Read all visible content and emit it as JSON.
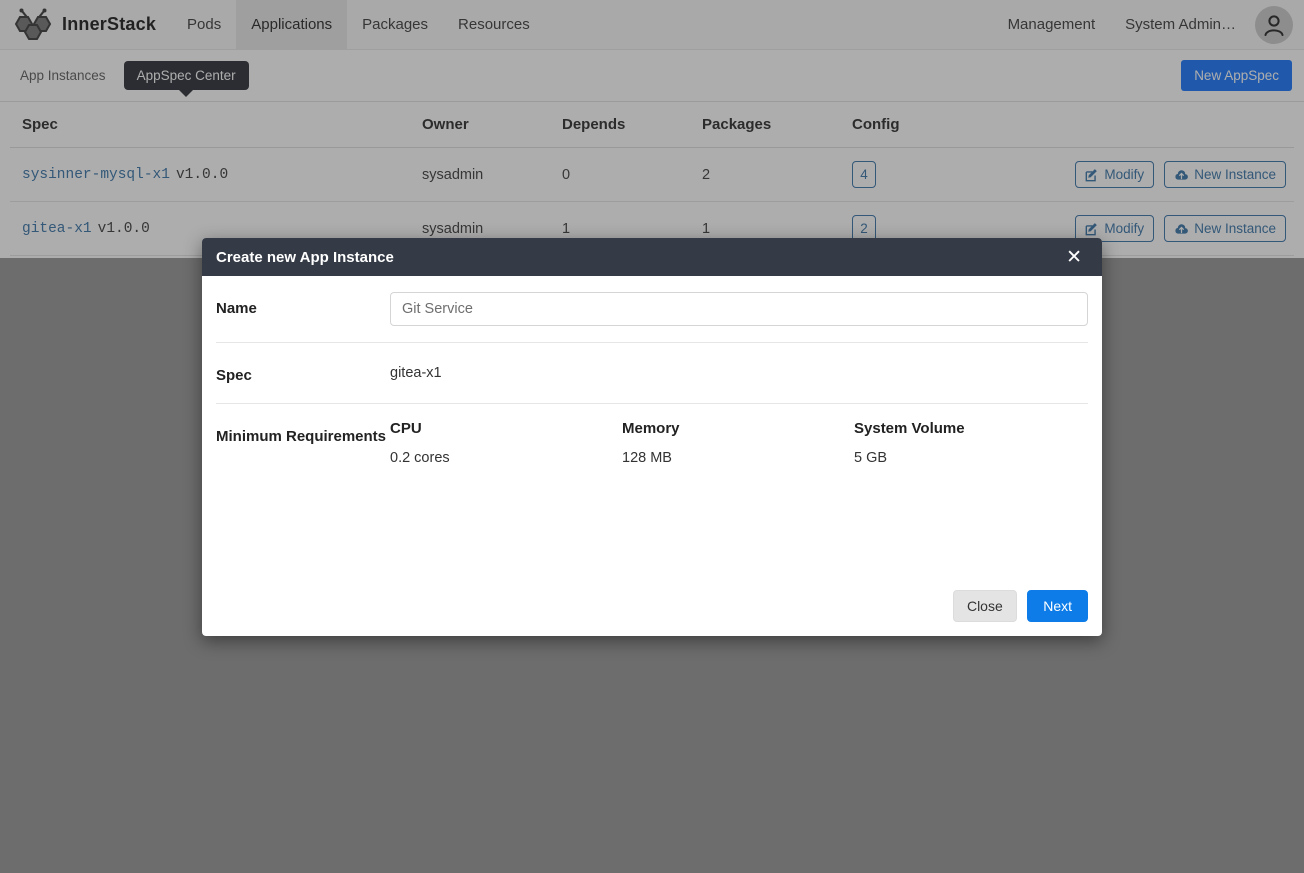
{
  "navbar": {
    "logo_icon": "bee-hexagon-logo-icon",
    "brand": "InnerStack",
    "links": [
      {
        "label": "Pods",
        "active": false
      },
      {
        "label": "Applications",
        "active": true
      },
      {
        "label": "Packages",
        "active": false
      },
      {
        "label": "Resources",
        "active": false
      }
    ],
    "right_links": [
      {
        "label": "Management"
      },
      {
        "label": "System Admin…"
      }
    ],
    "avatar_icon": "user-avatar-icon"
  },
  "subbar": {
    "tab_app_instances": "App Instances",
    "tab_appspec_center": "AppSpec Center",
    "new_appspec_label": "New AppSpec",
    "accent_color": "#0d6efd"
  },
  "table": {
    "headers": [
      "Spec",
      "Owner",
      "Depends",
      "Packages",
      "Config",
      ""
    ],
    "rows": [
      {
        "spec_name": "sysinner-mysql-x1",
        "spec_version": "v1.0.0",
        "owner": "sysadmin",
        "depends": "0",
        "packages": "2",
        "config": "4",
        "modify_label": "Modify",
        "new_instance_label": "New Instance"
      },
      {
        "spec_name": "gitea-x1",
        "spec_version": "v1.0.0",
        "owner": "sysadmin",
        "depends": "1",
        "packages": "1",
        "config": "2",
        "modify_label": "Modify",
        "new_instance_label": "New Instance"
      }
    ],
    "link_color": "#2e6da4"
  },
  "modal": {
    "title": "Create new App Instance",
    "close_icon": "close-x-icon",
    "name_label": "Name",
    "name_value": "",
    "name_placeholder": "Git Service",
    "spec_label": "Spec",
    "spec_value": "gitea-x1",
    "min_req_label": "Minimum Requirements",
    "requirements": [
      {
        "title": "CPU",
        "value": "0.2 cores"
      },
      {
        "title": "Memory",
        "value": "128 MB"
      },
      {
        "title": "System Volume",
        "value": "5 GB"
      }
    ],
    "close_button": "Close",
    "next_button": "Next",
    "next_color": "#0d7ce8"
  }
}
